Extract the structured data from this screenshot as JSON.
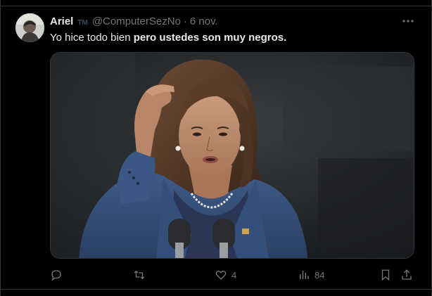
{
  "tweet": {
    "author_name": "Ariel",
    "badge": "TM",
    "handle": "@ComputerSezNo",
    "separator": "·",
    "date": "6 nov.",
    "text_plain": "Yo hice todo bien ",
    "text_bold": "pero ustedes son muy negros."
  },
  "actions": {
    "reply_count": "",
    "retweet_count": "",
    "like_count": "4",
    "views_count": "84"
  },
  "icons": [
    "more-icon",
    "reply-icon",
    "retweet-icon",
    "like-icon",
    "views-icon",
    "bookmark-icon",
    "share-icon"
  ],
  "colors": {
    "background": "#000000",
    "text": "#e7e9ea",
    "muted": "#71767b",
    "border": "#2f3336"
  }
}
